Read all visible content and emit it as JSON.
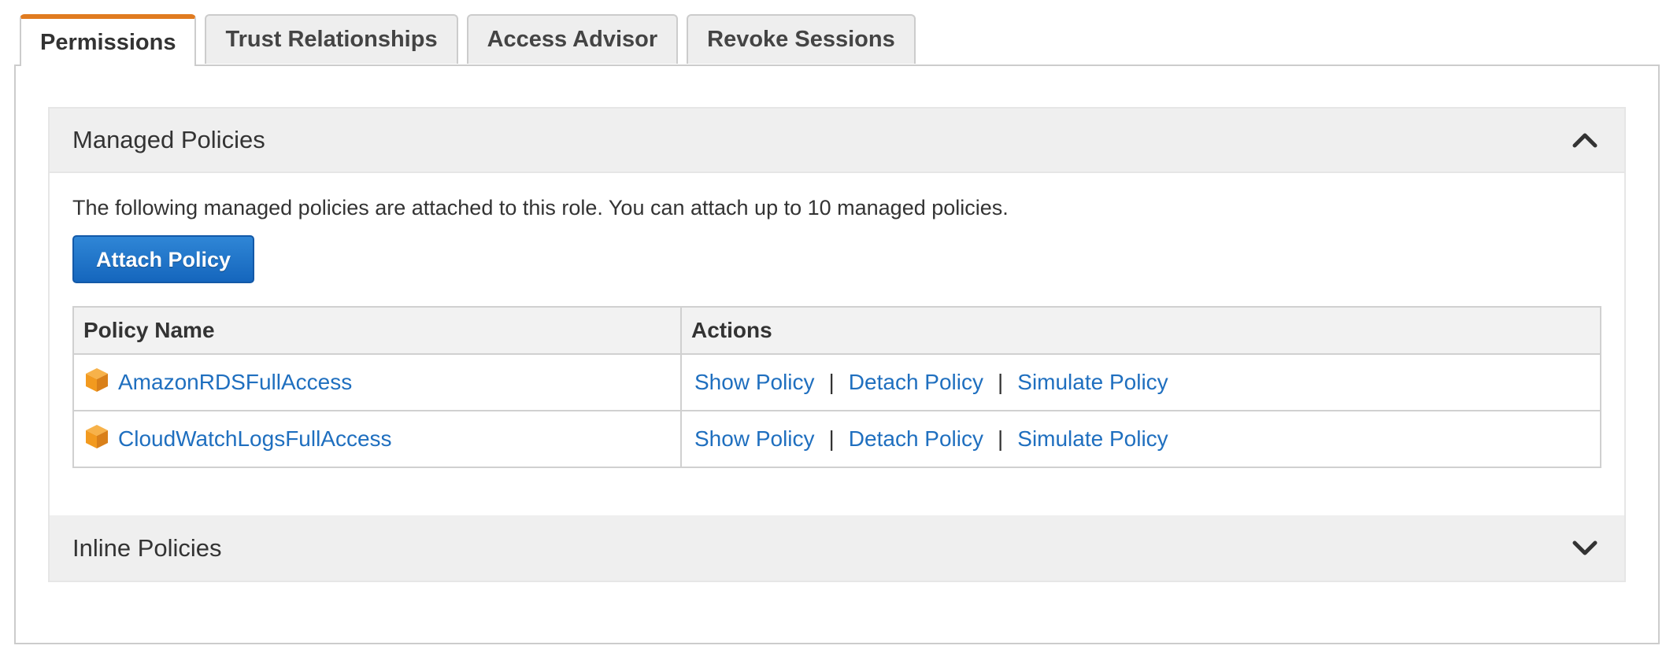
{
  "tabs": [
    {
      "label": "Permissions",
      "active": true
    },
    {
      "label": "Trust Relationships",
      "active": false
    },
    {
      "label": "Access Advisor",
      "active": false
    },
    {
      "label": "Revoke Sessions",
      "active": false
    }
  ],
  "managed": {
    "title": "Managed Policies",
    "collapse_icon": "chevron-up-icon",
    "description": "The following managed policies are attached to this role. You can attach up to 10 managed policies.",
    "attach_button": "Attach Policy",
    "table": {
      "columns": [
        "Policy Name",
        "Actions"
      ],
      "rows": [
        {
          "name": "AmazonRDSFullAccess",
          "icon": "managed-policy-cube-icon",
          "actions": [
            "Show Policy",
            "Detach Policy",
            "Simulate Policy"
          ]
        },
        {
          "name": "CloudWatchLogsFullAccess",
          "icon": "managed-policy-cube-icon",
          "actions": [
            "Show Policy",
            "Detach Policy",
            "Simulate Policy"
          ]
        }
      ],
      "separator": "|"
    }
  },
  "inline": {
    "title": "Inline Policies",
    "expand_icon": "chevron-down-icon"
  },
  "colors": {
    "active_tab_accent": "#e07b20",
    "link": "#1f6fbf",
    "primary_button": "#1566bd",
    "policy_icon": "#f29a1f"
  }
}
